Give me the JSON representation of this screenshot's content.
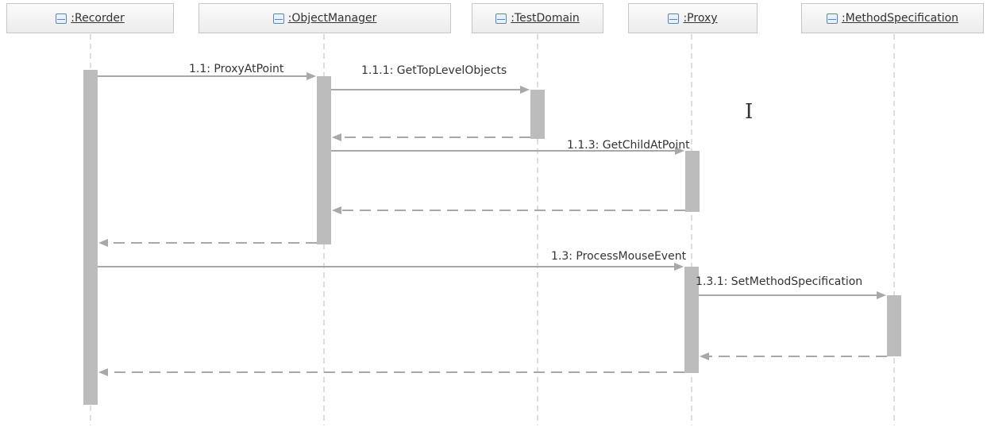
{
  "lifelines": [
    {
      "id": "recorder",
      "name": ":Recorder"
    },
    {
      "id": "objectmanager",
      "name": ":ObjectManager"
    },
    {
      "id": "testdomain",
      "name": ":TestDomain"
    },
    {
      "id": "proxy",
      "name": ":Proxy"
    },
    {
      "id": "methodspecification",
      "name": ":MethodSpecification"
    }
  ],
  "messages": [
    {
      "label": "1.1: ProxyAtPoint",
      "from": "recorder",
      "to": "objectmanager",
      "kind": "call"
    },
    {
      "label": "1.1.1: GetTopLevelObjects",
      "from": "objectmanager",
      "to": "testdomain",
      "kind": "call"
    },
    {
      "label": "",
      "from": "testdomain",
      "to": "objectmanager",
      "kind": "return"
    },
    {
      "label": "1.1.3: GetChildAtPoint",
      "from": "objectmanager",
      "to": "proxy",
      "kind": "call"
    },
    {
      "label": "",
      "from": "proxy",
      "to": "objectmanager",
      "kind": "return"
    },
    {
      "label": "",
      "from": "objectmanager",
      "to": "recorder",
      "kind": "return"
    },
    {
      "label": "1.3: ProcessMouseEvent",
      "from": "recorder",
      "to": "proxy",
      "kind": "call"
    },
    {
      "label": "1.3.1: SetMethodSpecification",
      "from": "proxy",
      "to": "methodspecification",
      "kind": "call"
    },
    {
      "label": "",
      "from": "methodspecification",
      "to": "proxy",
      "kind": "return"
    },
    {
      "label": "",
      "from": "proxy",
      "to": "recorder",
      "kind": "return"
    }
  ],
  "cursor": {
    "icon": "text-cursor-icon",
    "glyph": "I"
  }
}
